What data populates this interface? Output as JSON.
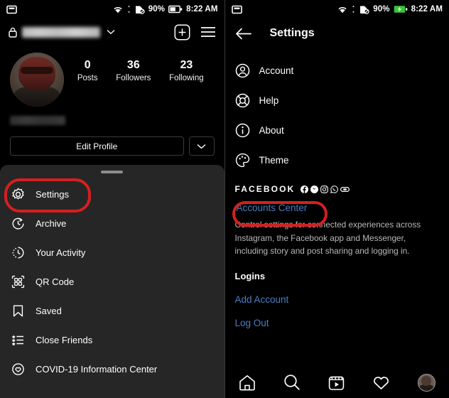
{
  "status_bar": {
    "left_icon": "photo-icon",
    "wifi_icon": "wifi-icon",
    "sd_icon": "sd-card-off-icon",
    "battery_pct": "90%",
    "battery_icon": "battery-icon",
    "time": "8:22 AM"
  },
  "left_panel": {
    "header": {
      "lock_icon": "lock-icon",
      "username": "",
      "username_censored": true,
      "chevron_icon": "chevron-down-icon",
      "add_icon": "plus-square-icon",
      "menu_icon": "hamburger-menu-icon"
    },
    "profile": {
      "avatar_alt": "profile-avatar",
      "full_name": "",
      "full_name_censored": true,
      "stats": [
        {
          "num": "0",
          "label": "Posts"
        },
        {
          "num": "36",
          "label": "Followers"
        },
        {
          "num": "23",
          "label": "Following"
        }
      ],
      "edit_profile_label": "Edit Profile",
      "dropdown_icon": "chevron-down-icon"
    },
    "sheet": {
      "items": [
        {
          "label": "Settings",
          "icon": "gear-icon",
          "highlighted": true
        },
        {
          "label": "Archive",
          "icon": "archive-clock-icon",
          "highlighted": false
        },
        {
          "label": "Your Activity",
          "icon": "activity-clock-icon",
          "highlighted": false
        },
        {
          "label": "QR Code",
          "icon": "qr-code-icon",
          "highlighted": false
        },
        {
          "label": "Saved",
          "icon": "bookmark-icon",
          "highlighted": false
        },
        {
          "label": "Close Friends",
          "icon": "star-list-icon",
          "highlighted": false
        },
        {
          "label": "COVID-19 Information Center",
          "icon": "covid-heart-icon",
          "highlighted": false
        }
      ]
    }
  },
  "right_panel": {
    "header": {
      "back_icon": "back-arrow-icon",
      "title": "Settings"
    },
    "items": [
      {
        "label": "Account",
        "icon": "account-person-icon"
      },
      {
        "label": "Help",
        "icon": "help-lifebuoy-icon"
      },
      {
        "label": "About",
        "icon": "info-icon"
      },
      {
        "label": "Theme",
        "icon": "theme-palette-icon"
      }
    ],
    "facebook_section": {
      "heading": "FACEBOOK",
      "brand_icons": [
        "facebook-icon",
        "messenger-icon",
        "instagram-icon",
        "whatsapp-icon",
        "oculus-icon"
      ],
      "link_label": "Accounts Center",
      "link_highlighted": true,
      "description": "Control settings for connected experiences across Instagram, the Facebook app and Messenger, including story and post sharing and logging in."
    },
    "logins_section": {
      "heading": "Logins",
      "add_account_label": "Add Account",
      "log_out_label": "Log Out"
    },
    "tabbar": {
      "items": [
        "home-icon",
        "search-icon",
        "reels-icon",
        "heart-icon",
        "profile-avatar-icon"
      ]
    }
  },
  "colors": {
    "background": "#000000",
    "sheet": "#262626",
    "link_blue": "#4a7ec4",
    "highlight_red": "#d32020",
    "muted_text": "#b8b8b8",
    "battery_green": "#37c637"
  }
}
